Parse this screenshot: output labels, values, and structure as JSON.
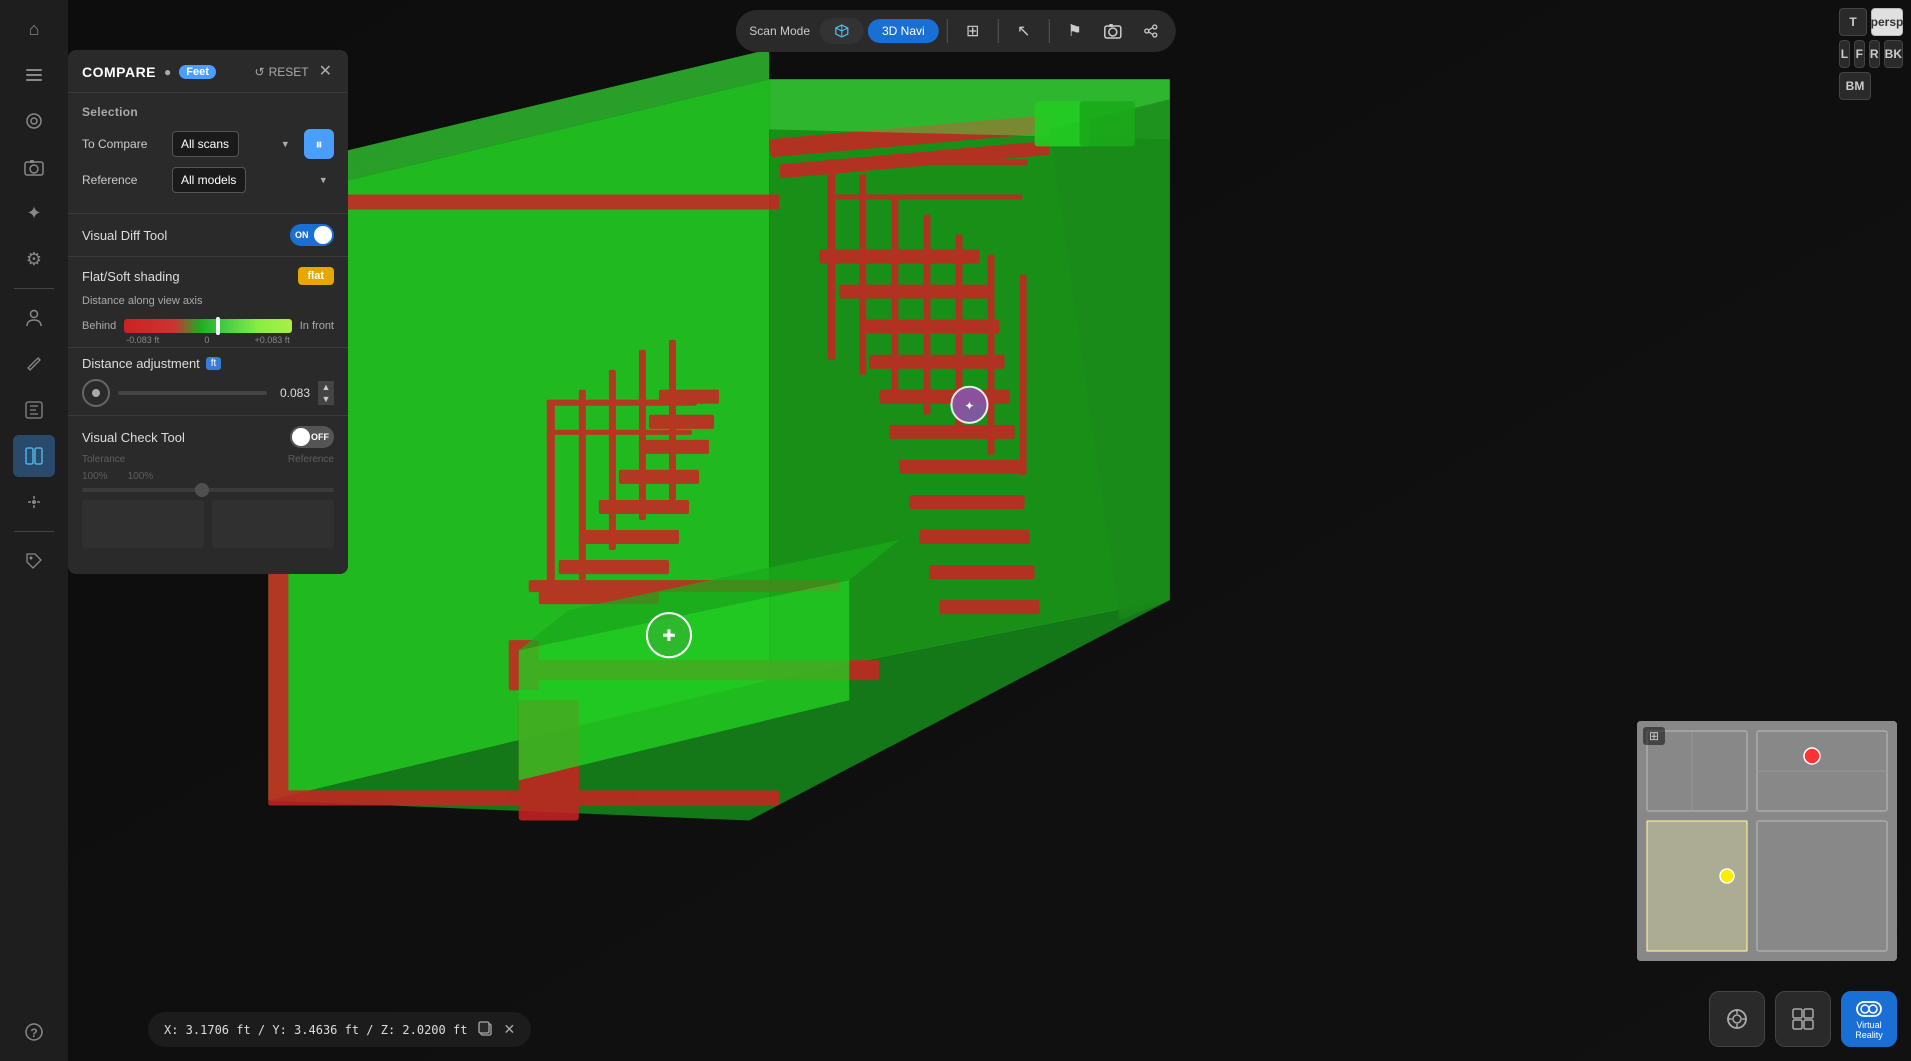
{
  "sidebar": {
    "icons": [
      {
        "name": "home-icon",
        "symbol": "⌂",
        "active": false
      },
      {
        "name": "layers-icon",
        "symbol": "◫",
        "active": false
      },
      {
        "name": "view-icon",
        "symbol": "◉",
        "active": false
      },
      {
        "name": "camera-icon",
        "symbol": "⊡",
        "active": false
      },
      {
        "name": "star-icon",
        "symbol": "✦",
        "active": false
      },
      {
        "name": "settings-icon",
        "symbol": "⚙",
        "active": false
      },
      {
        "name": "person-icon",
        "symbol": "👤",
        "active": false
      },
      {
        "name": "edit-icon",
        "symbol": "✏",
        "active": false
      },
      {
        "name": "measure-icon",
        "symbol": "⊞",
        "active": false
      },
      {
        "name": "compare-icon",
        "symbol": "⊟",
        "active": true
      },
      {
        "name": "tag-icon",
        "symbol": "⊛",
        "active": false
      },
      {
        "name": "help-icon",
        "symbol": "?",
        "active": false
      }
    ]
  },
  "panel": {
    "title": "COMPARE",
    "feet_badge": "Feet",
    "reset_label": "RESET",
    "selection_label": "Selection",
    "to_compare_label": "To Compare",
    "to_compare_value": "All scans",
    "reference_label": "Reference",
    "reference_value": "All models",
    "visual_diff_label": "Visual Diff Tool",
    "visual_diff_on": "ON",
    "shading_label": "Flat/Soft shading",
    "shading_value": "flat",
    "distance_axis_label": "Distance along view axis",
    "behind_label": "Behind",
    "in_front_label": "In front",
    "tick_minus": "-0.083 ft",
    "tick_zero": "0",
    "tick_plus": "+0.083 ft",
    "distance_adj_label": "Distance adjustment",
    "ft_badge": "ft",
    "distance_value": "0.083",
    "visual_check_label": "Visual Check Tool",
    "visual_check_off": "OFF",
    "tolerance_label": "Tolerance",
    "tolerance_value": "100%",
    "reference_opacity_label": "Reference",
    "reference_opacity_value": "100%"
  },
  "topbar": {
    "scan_mode_label": "Scan Mode",
    "navi_label": "3D Navi",
    "grid_icon": "⊞",
    "cursor_icon": "↖",
    "flag_icon": "⚑",
    "camera_icon": "📷",
    "share_icon": "⇧"
  },
  "view_buttons": {
    "persp_label": "persp",
    "t_label": "T",
    "l_label": "L",
    "f_label": "F",
    "r_label": "R",
    "bk_label": "BK",
    "bm_label": "BM"
  },
  "status_bar": {
    "coords": "X: 3.1706 ft / Y: 3.4636 ft / Z: 2.0200 ft"
  },
  "bottom_right": {
    "target_icon": "◎",
    "grid_icon": "⊞",
    "vr_label": "Virtual Reality"
  }
}
